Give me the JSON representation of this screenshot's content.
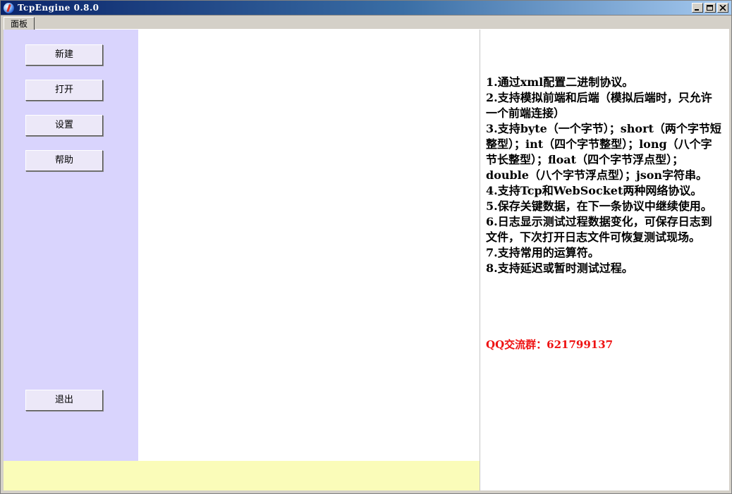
{
  "window": {
    "title": "TcpEngine 0.8.0",
    "icon": "app-globe-icon"
  },
  "tabs": [
    {
      "label": "面板"
    }
  ],
  "sidebar": {
    "buttons": [
      {
        "label": "新建"
      },
      {
        "label": "打开"
      },
      {
        "label": "设置"
      },
      {
        "label": "帮助"
      }
    ],
    "exit_label": "退出"
  },
  "info": {
    "lines": [
      "1.通过xml配置二进制协议。",
      "2.支持模拟前端和后端（模拟后端时，只允许一个前端连接）",
      "3.支持byte（一个字节）；short（两个字节短整型）；int（四个字节整型）；long（八个字节长整型）；float（四个字节浮点型）；double（八个字节浮点型）；json字符串。",
      "4.支持Tcp和WebSocket两种网络协议。",
      "5.保存关键数据，在下一条协议中继续使用。",
      "6.日志显示测试过程数据变化，可保存日志到文件，下次打开日志文件可恢复测试现场。",
      "7.支持常用的运算符。",
      "8.支持延迟或暂时测试过程。"
    ],
    "qq": "QQ交流群：621799137"
  },
  "colors": {
    "sidebar_bg": "#d9d4fd",
    "status_bg": "#fafcb9",
    "qq_text": "#ee1111"
  }
}
